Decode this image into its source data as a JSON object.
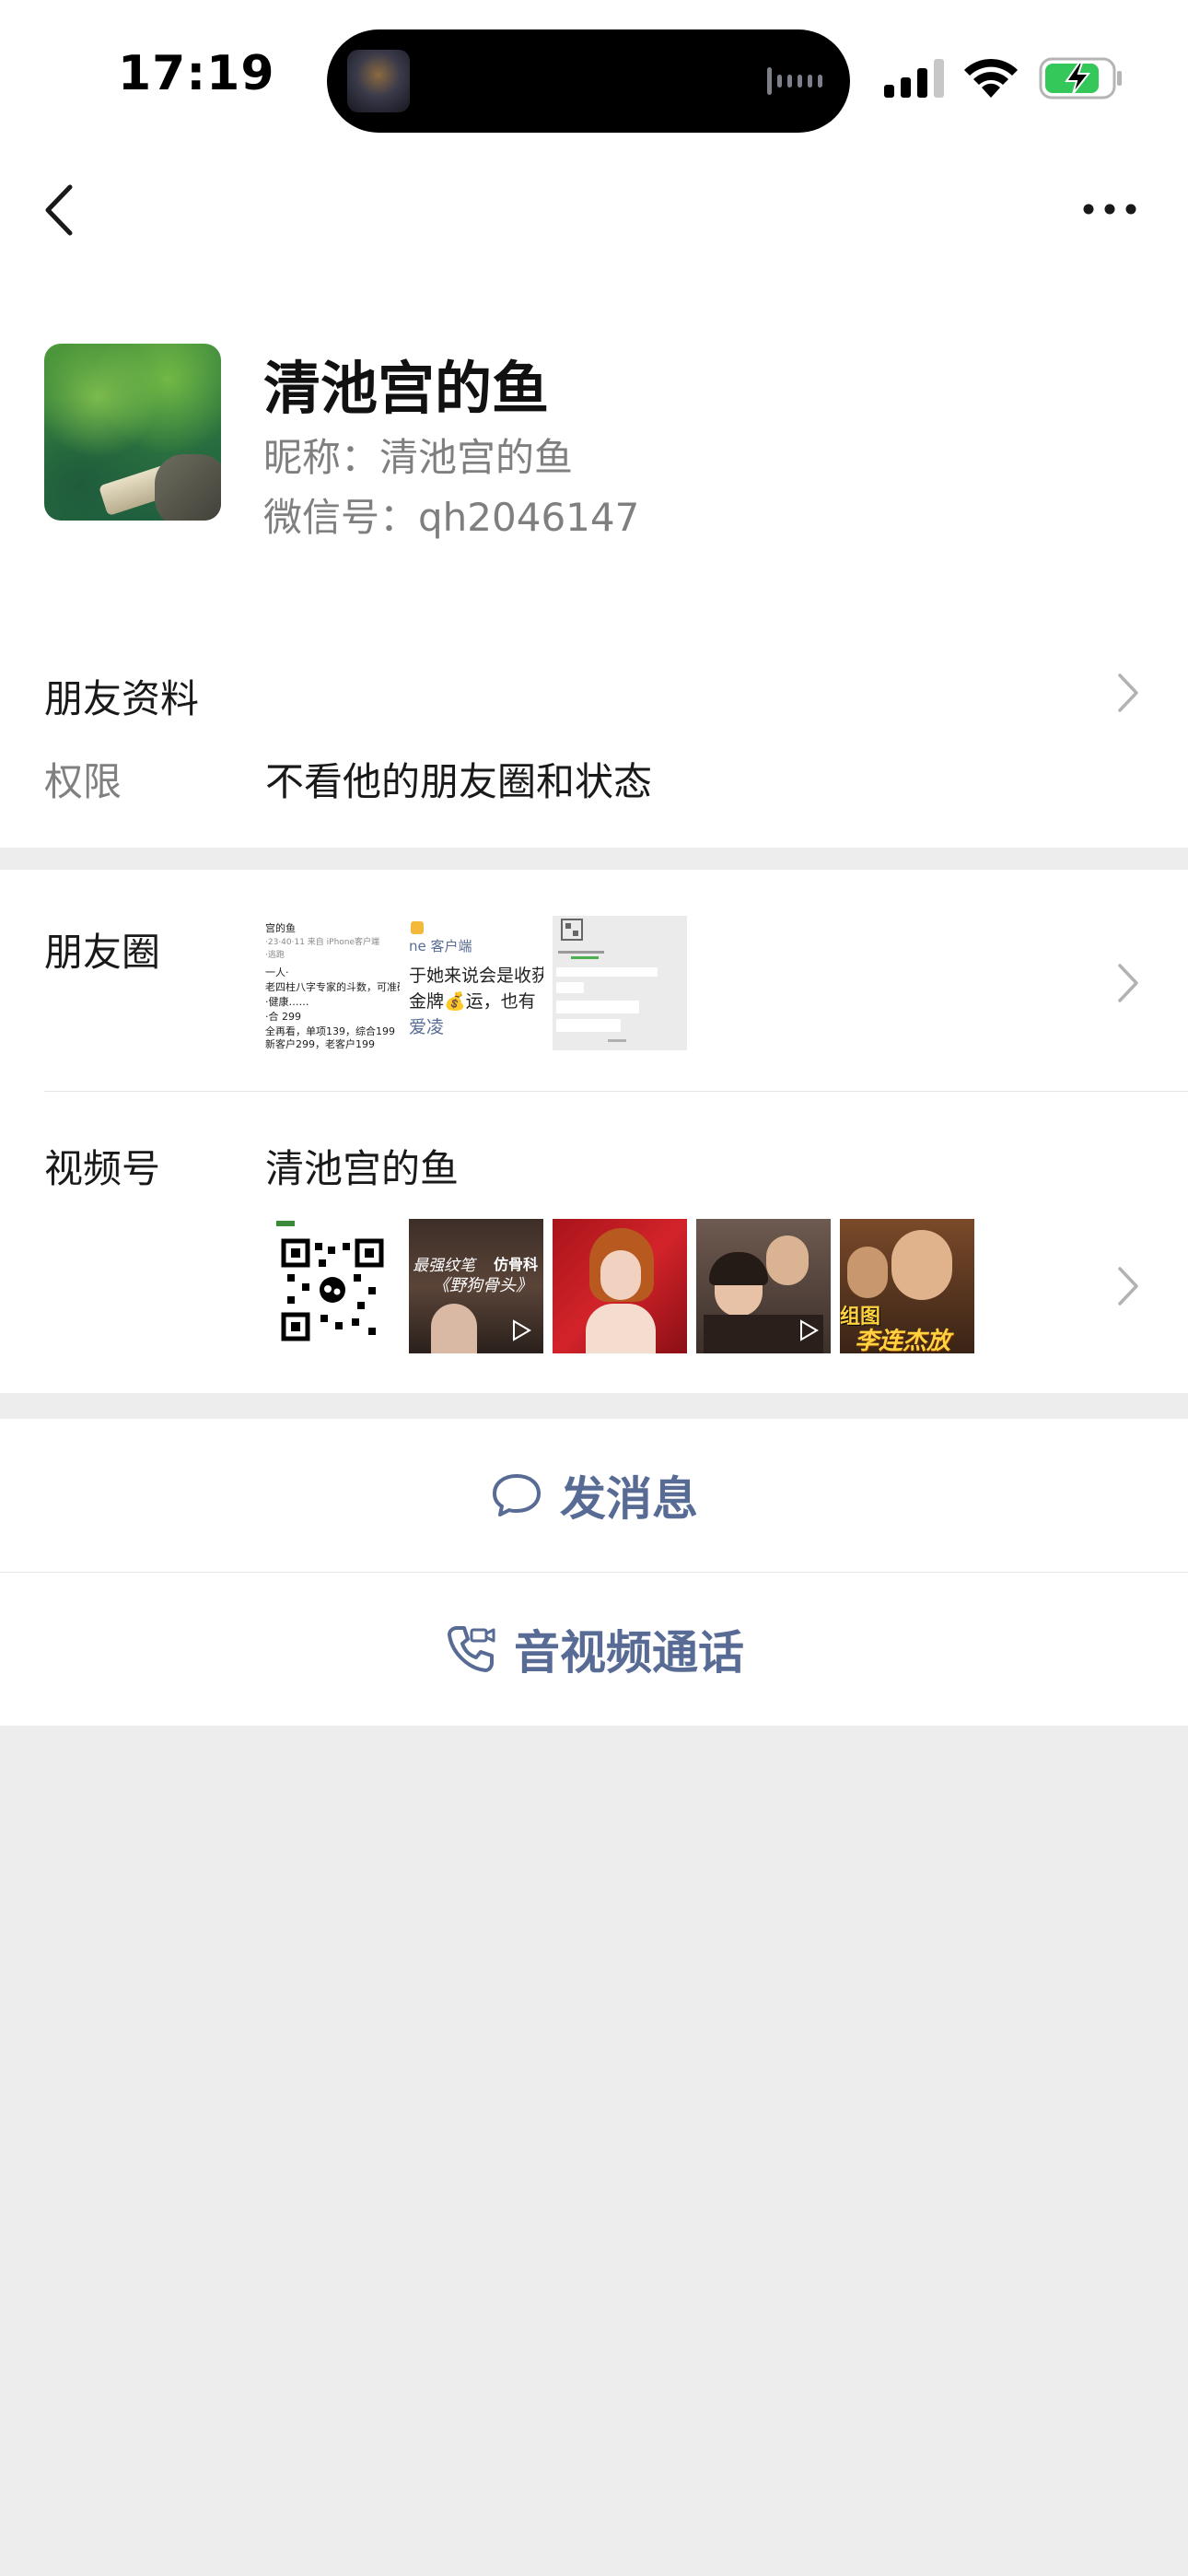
{
  "status_bar": {
    "time": "17:19",
    "icons": [
      "now-playing-thumbnail",
      "audio-wave-icon",
      "cellular-signal-icon",
      "wifi-icon",
      "battery-charging-icon"
    ]
  },
  "header": {
    "back_icon": "chevron-left-icon",
    "more_icon": "more-dots-icon"
  },
  "profile": {
    "display_name": "清池宫的鱼",
    "nickname": "昵称：清池宫的鱼",
    "wechat_id": "微信号：qh2046147"
  },
  "friend_info": {
    "title": "朋友资料",
    "permission_label": "权限",
    "permission_value": "不看他的朋友圈和状态"
  },
  "moments": {
    "label": "朋友圈",
    "thumbs": [
      {
        "lines": [
          "宫的鱼",
          "·23·40·11 来自 iPhone客户端",
          "·逃跑",
          "一人·",
          "老四柱八字专家的斗数，可准确",
          "·健康……",
          "·合 299",
          "全再看，单项139，综合199",
          "新客户299，老客户199"
        ]
      },
      {
        "lines": [
          "ne 客户端",
          "于她来说会是收获",
          "金牌💰运，也有",
          "爱凌"
        ]
      },
      {
        "lines": [
          "",
          "",
          "",
          "",
          ""
        ]
      }
    ]
  },
  "channels": {
    "label": "视频号",
    "name": "清池宫的鱼",
    "thumbs": [
      {
        "type": "qr-code"
      },
      {
        "title_top": "最强纹笔",
        "title_right": "仿骨科",
        "title_mid": "《野狗骨头》"
      },
      {
        "type": "portrait-red"
      },
      {
        "type": "couple-photo"
      },
      {
        "overlay_text": "李连杰放",
        "tag": "组图"
      }
    ]
  },
  "actions": {
    "message_label": "发消息",
    "call_label": "音视频通话",
    "message_icon": "chat-bubble-icon",
    "call_icon": "video-call-phone-icon"
  },
  "colors": {
    "link_blue": "#576b95",
    "background": "#ededed",
    "card": "#ffffff"
  }
}
